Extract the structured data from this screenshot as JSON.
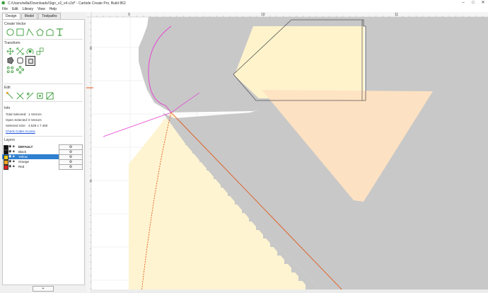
{
  "window": {
    "title": "C:/Users/willa/Downloads/Sign_v2_v4.c2d* - Carbide Create Pro, Build 862",
    "controls": [
      "–",
      "□",
      "✕"
    ]
  },
  "menu": [
    "File",
    "Edit",
    "Library",
    "View",
    "Help"
  ],
  "tabs": [
    "Design",
    "Model",
    "Toolpaths"
  ],
  "sections": {
    "create_vector": "Create Vector",
    "transform": "Transform",
    "edit": "Edit",
    "info": "Info",
    "layers": "Layers"
  },
  "info": {
    "total_selected_label": "Total Selected:",
    "total_selected_value": "1 Vectors",
    "open_selected_label": "Open Selected:",
    "open_selected_value": "0 Vectors",
    "selected_size_label": "Selected Size:",
    "selected_size_value": "4.529 x 7.450",
    "check_link": "Check Cutter Access"
  },
  "layers": [
    {
      "name": "DEFAULT",
      "color": "#111111",
      "selected": false,
      "bold": true
    },
    {
      "name": "Black",
      "color": "#111111",
      "selected": false,
      "bold": false
    },
    {
      "name": "Yellow",
      "color": "#f4d21a",
      "selected": true,
      "bold": false
    },
    {
      "name": "Orange",
      "color": "#f5a623",
      "selected": false,
      "bold": false
    },
    {
      "name": "Red",
      "color": "#e02020",
      "selected": false,
      "bold": false
    }
  ],
  "layer_button_glyph": "⚙",
  "add_layer_label": "+",
  "ruler": {
    "top_labels": [
      "9",
      "10",
      "11"
    ],
    "left_labels": [
      "10",
      "11"
    ]
  },
  "colors": {
    "accent": "#2f7fd0",
    "canvas_gray": "#c8c8c8",
    "fill_peach": "#ffe6c7",
    "fill_cream": "#fff3cc",
    "vector_magenta": "#e83ad0",
    "vector_orange": "#e05a1a"
  }
}
